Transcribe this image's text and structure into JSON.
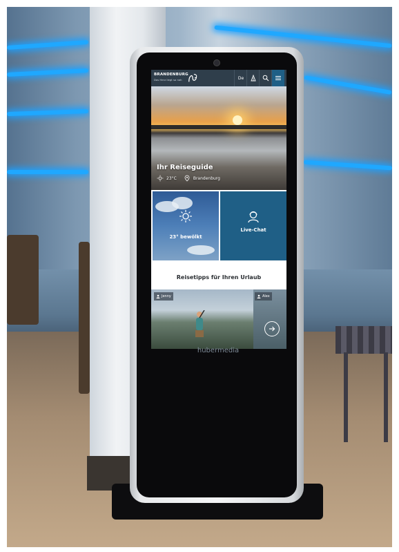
{
  "kiosk": {
    "brand": "hubermedia",
    "topbar": {
      "logo_title": "BRANDENBURG",
      "logo_subtitle": "Das Herz liegt so nah",
      "language": "De",
      "icons": [
        "hiking-icon",
        "search-icon",
        "menu-icon"
      ]
    },
    "hero": {
      "title": "Ihr Reiseguide",
      "temperature": "23°C",
      "location": "Brandenburg"
    },
    "tiles": {
      "weather_label": "23° bewölkt",
      "chat_label": "Live-Chat"
    },
    "tips": {
      "title": "Reisetipps für Ihren Urlaub",
      "card_left_name": "Jenny",
      "card_right_name": "Alex"
    },
    "colors": {
      "topbar": "#2f3e4b",
      "chat_tile": "#1f5f86",
      "weather_tile": "#2f5b96",
      "neon": "#1fa8ff"
    }
  }
}
